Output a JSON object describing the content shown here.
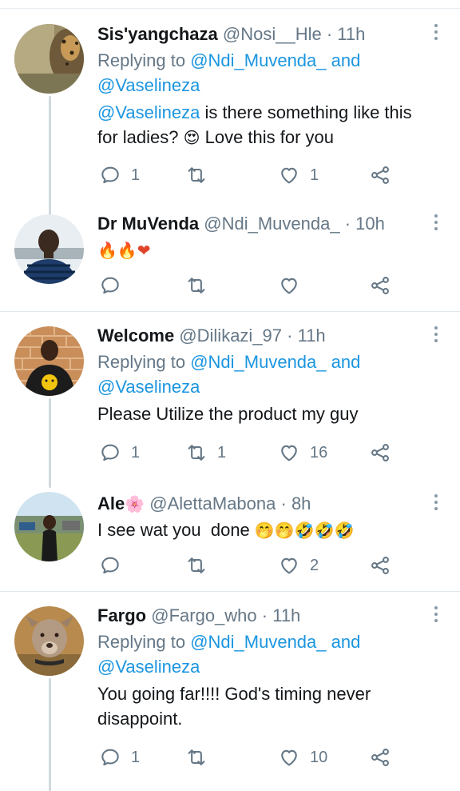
{
  "tweets": [
    {
      "name": "Sis'yangchaza",
      "handle": "@Nosi__Hle",
      "dot": " · ",
      "time": "11h",
      "replying_prefix": "Replying to ",
      "reply_mention_1": "@Ndi_Muvenda_",
      "reply_and": " and",
      "reply_mention_2": "@Vaselineza",
      "text_mention": "@Vaselineza",
      "text_1": " is there something like this for ladies? ",
      "emoji": "😍",
      "text_2": " Love this for you",
      "reply_count": "1",
      "retweet_count": "",
      "like_count": "1"
    },
    {
      "name": "Dr MuVenda",
      "handle": "@Ndi_Muvenda_",
      "dot": " · ",
      "time": "10h",
      "text_emoji": "🔥🔥❤",
      "reply_count": "",
      "retweet_count": "",
      "like_count": ""
    },
    {
      "name": "Welcome",
      "handle": "@Dilikazi_97",
      "dot": " · ",
      "time": "11h",
      "replying_prefix": "Replying to ",
      "reply_mention_1": "@Ndi_Muvenda_",
      "reply_and": " and",
      "reply_mention_2": "@Vaselineza",
      "text": "Please Utilize the product my guy",
      "reply_count": "1",
      "retweet_count": "1",
      "like_count": "16"
    },
    {
      "name": "Ale",
      "name_emoji": "🌸",
      "handle": "@AlettaMabona",
      "dot": " · ",
      "time": "8h",
      "text": "I see wat you  done ",
      "text_emoji": "🤭🤭🤣🤣🤣",
      "reply_count": "",
      "retweet_count": "",
      "like_count": "2"
    },
    {
      "name": "Fargo",
      "handle": "@Fargo_who",
      "dot": " · ",
      "time": "11h",
      "replying_prefix": "Replying to ",
      "reply_mention_1": "@Ndi_Muvenda_",
      "reply_and": " and",
      "reply_mention_2": "@Vaselineza",
      "text": "You going far!!!! God's timing never disappoint.",
      "reply_count": "1",
      "retweet_count": "",
      "like_count": "10"
    }
  ],
  "icons": {
    "reply": "reply-icon",
    "retweet": "retweet-icon",
    "like": "heart-icon",
    "share": "share-icon",
    "more": "more-options-icon"
  },
  "colors": {
    "mention": "#1b95e0",
    "secondary_text": "#657786",
    "divider": "#e1e8ed",
    "thread_line": "#cfd9de"
  }
}
